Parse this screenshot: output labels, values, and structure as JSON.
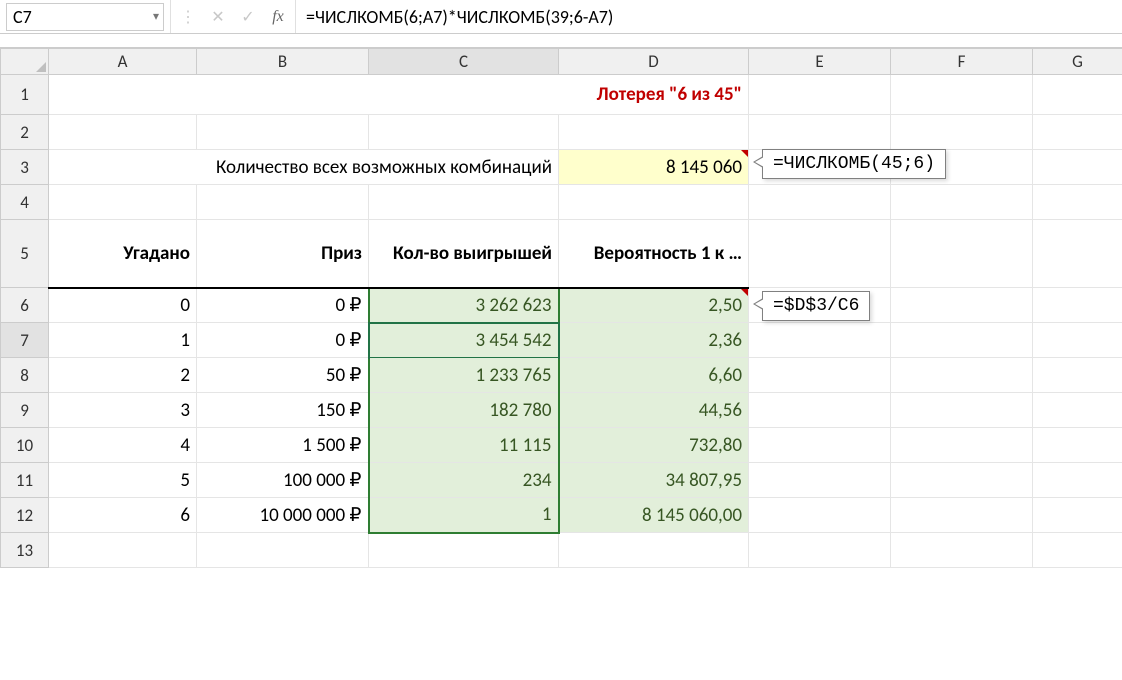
{
  "formula_bar": {
    "cell_ref": "C7",
    "formula": "=ЧИСЛКОМБ(6;A7)*ЧИСЛКОМБ(39;6-A7)"
  },
  "columns": [
    "A",
    "B",
    "C",
    "D",
    "E",
    "F",
    "G"
  ],
  "rows": [
    "1",
    "2",
    "3",
    "4",
    "5",
    "6",
    "7",
    "8",
    "9",
    "10",
    "11",
    "12",
    "13"
  ],
  "title": "Лотерея \"6 из 45\"",
  "combo_label": "Количество всех возможных комбинаций",
  "combo_value": "8 145 060",
  "headers": {
    "a": "Угадано",
    "b": "Приз",
    "c": "Кол-во выигрышей",
    "d": "Вероятность 1 к …"
  },
  "data": [
    {
      "a": "0",
      "b": "0 ₽",
      "c": "3 262 623",
      "d": "2,50"
    },
    {
      "a": "1",
      "b": "0 ₽",
      "c": "3 454 542",
      "d": "2,36"
    },
    {
      "a": "2",
      "b": "50 ₽",
      "c": "1 233 765",
      "d": "6,60"
    },
    {
      "a": "3",
      "b": "150 ₽",
      "c": "182 780",
      "d": "44,56"
    },
    {
      "a": "4",
      "b": "1 500 ₽",
      "c": "11 115",
      "d": "732,80"
    },
    {
      "a": "5",
      "b": "100 000 ₽",
      "c": "234",
      "d": "34 807,95"
    },
    {
      "a": "6",
      "b": "10 000 000 ₽",
      "c": "1",
      "d": "8 145 060,00"
    }
  ],
  "callouts": {
    "d3": "=ЧИСЛКОМБ(45;6)",
    "d6": "=$D$3/C6"
  }
}
